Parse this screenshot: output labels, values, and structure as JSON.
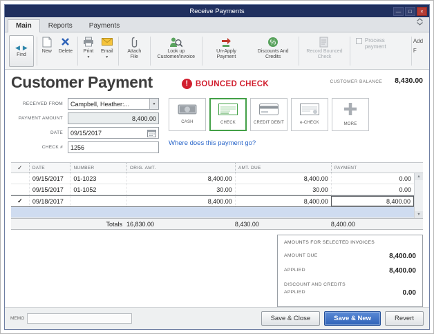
{
  "colors": {
    "titlebar_navy": "#20305f",
    "accent_blue": "#2f63b8",
    "alert_red": "#d11f2f",
    "selected_green": "#43a047",
    "link_blue": "#2a66c9",
    "highlight_row_blue": "#cfdcf0"
  },
  "icons": {
    "check_mark": "✓",
    "dropdown_arrow": "▼",
    "up_arrow": "▲",
    "down_arrow": "▼",
    "left_arrow": "◀",
    "right_arrow": "▶",
    "minimize": "—",
    "maximize": "□",
    "close": "×",
    "exclamation": "!"
  },
  "window": {
    "title": "Receive Payments"
  },
  "tabs": [
    {
      "label": "Main"
    },
    {
      "label": "Reports"
    },
    {
      "label": "Payments"
    }
  ],
  "toolbar": {
    "find": "Find",
    "new": "New",
    "delete": "Delete",
    "print": "Print",
    "email": "Email",
    "attach": "Attach File",
    "lookup": "Look up Customer/Invoice",
    "unapply": "Un-Apply Payment",
    "discounts": "Discounts And Credits",
    "record_bounced": "Record Bounced Check",
    "process_payment": "Process payment",
    "overflow_top": "Add",
    "overflow_bottom": "F"
  },
  "header": {
    "title": "Customer Payment",
    "bounced_check": "BOUNCED CHECK",
    "customer_balance_label": "CUSTOMER BALANCE",
    "customer_balance_value": "8,430.00"
  },
  "form": {
    "received_from_label": "RECEIVED FROM",
    "received_from_value": "Campbell, Heather:...",
    "payment_amount_label": "PAYMENT AMOUNT",
    "payment_amount_value": "8,400.00",
    "date_label": "DATE",
    "date_value": "09/15/2017",
    "check_number_label": "CHECK #",
    "check_number_value": "1256",
    "where_link": "Where does this payment go?"
  },
  "payment_methods": [
    {
      "label": "CASH",
      "selected": false
    },
    {
      "label": "CHECK",
      "selected": true
    },
    {
      "label": "CREDIT DEBIT",
      "selected": false
    },
    {
      "label": "e-CHECK",
      "selected": false
    },
    {
      "label": "MORE",
      "selected": false
    }
  ],
  "table": {
    "headers": {
      "date": "DATE",
      "number": "NUMBER",
      "orig_amt": "ORIG. AMT.",
      "amt_due": "AMT. DUE",
      "payment": "PAYMENT"
    },
    "rows": [
      {
        "check": "",
        "date": "09/15/2017",
        "number": "01-1023",
        "orig_amt": "8,400.00",
        "amt_due": "8,400.00",
        "payment": "0.00"
      },
      {
        "check": "",
        "date": "09/15/2017",
        "number": "01-1052",
        "orig_amt": "30.00",
        "amt_due": "30.00",
        "payment": "0.00"
      },
      {
        "check": "✓",
        "date": "09/18/2017",
        "number": "",
        "orig_amt": "8,400.00",
        "amt_due": "8,400.00",
        "payment": "8,400.00"
      }
    ],
    "totals_label": "Totals",
    "totals": {
      "orig_amt": "16,830.00",
      "amt_due": "8,430.00",
      "payment": "8,400.00"
    }
  },
  "summary": {
    "title": "AMOUNTS FOR SELECTED INVOICES",
    "amount_due_label": "AMOUNT DUE",
    "amount_due_value": "8,400.00",
    "applied_label": "APPLIED",
    "applied_value": "8,400.00",
    "discount_label": "DISCOUNT AND CREDITS APPLIED",
    "discount_value": "0.00"
  },
  "footer": {
    "memo_label": "MEMO",
    "memo_value": "",
    "save_close": "Save & Close",
    "save_new": "Save & New",
    "revert": "Revert"
  }
}
